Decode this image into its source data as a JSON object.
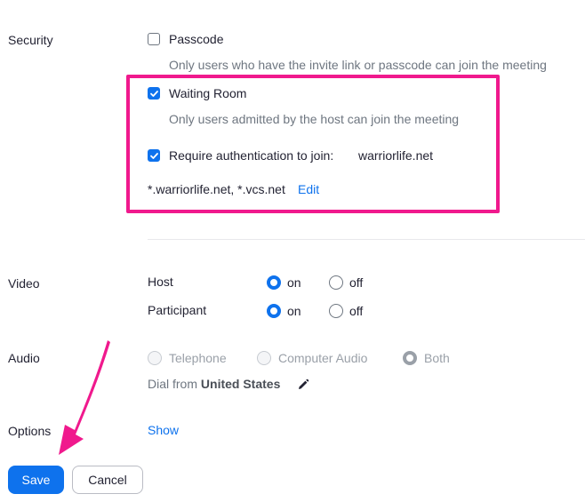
{
  "security": {
    "section_label": "Security",
    "passcode": {
      "label": "Passcode",
      "checked": false,
      "help": "Only users who have the invite link or passcode can join the meeting"
    },
    "waiting_room": {
      "label": "Waiting Room",
      "checked": true,
      "help": "Only users admitted by the host can join the meeting"
    },
    "require_auth": {
      "label": "Require authentication to join:",
      "value": "warriorlife.net",
      "checked": true,
      "domains": "*.warriorlife.net, *.vcs.net",
      "edit_label": "Edit"
    },
    "highlight_color": "#f0198d"
  },
  "video": {
    "section_label": "Video",
    "host": {
      "label": "Host",
      "on_label": "on",
      "off_label": "off",
      "selected": "on"
    },
    "participant": {
      "label": "Participant",
      "on_label": "on",
      "off_label": "off",
      "selected": "on"
    }
  },
  "audio": {
    "section_label": "Audio",
    "options": [
      "Telephone",
      "Computer Audio",
      "Both"
    ],
    "selected": "Both",
    "dial_from_prefix": "Dial from",
    "dial_from_country": "United States"
  },
  "options": {
    "section_label": "Options",
    "show_label": "Show"
  },
  "footer": {
    "save_label": "Save",
    "cancel_label": "Cancel"
  },
  "colors": {
    "accent": "#0e72ed",
    "annotation_pink": "#f0198d"
  },
  "icons": {
    "edit": "pencil-icon",
    "check": "checkmark-icon",
    "arrow": "arrow-annotation-icon"
  }
}
